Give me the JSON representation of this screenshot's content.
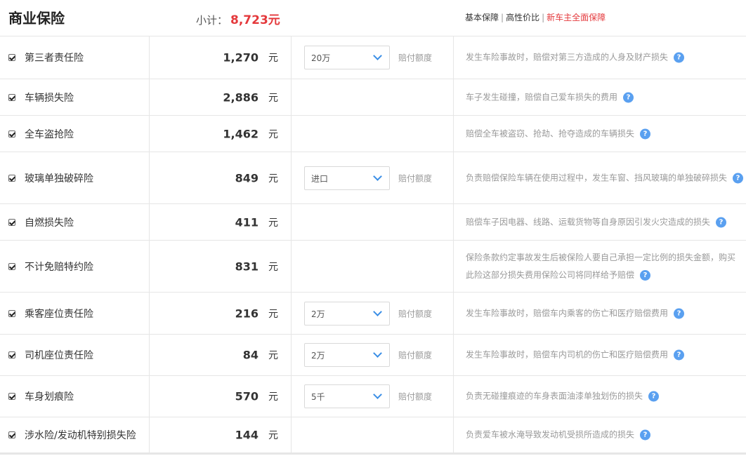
{
  "header": {
    "title": "商业保险",
    "subtotal_label": "小计：",
    "subtotal_amount": "8,723元",
    "toggles": [
      {
        "label": "基本保障"
      },
      {
        "label": "高性价比"
      },
      {
        "label": "新车主全面保障"
      }
    ],
    "active_color": "#e4393c"
  },
  "unit_label": "元",
  "option_label": "赔付额度",
  "rows": [
    {
      "name": "第三者责任险",
      "price": "1,270",
      "option": "20万",
      "desc": "发生车险事故时，赔偿对第三方造成的人身及财产损失",
      "checked": true
    },
    {
      "name": "车辆损失险",
      "price": "2,886",
      "option": null,
      "desc": "车子发生碰撞，赔偿自己爱车损失的费用",
      "checked": true
    },
    {
      "name": "全车盗抢险",
      "price": "1,462",
      "option": null,
      "desc": "赔偿全车被盗窃、抢劫、抢夺造成的车辆损失",
      "checked": true
    },
    {
      "name": "玻璃单独破碎险",
      "price": "849",
      "option": "进口",
      "desc": "负责赔偿保险车辆在使用过程中，发生车窗、挡风玻璃的单独破碎损失",
      "checked": true
    },
    {
      "name": "自燃损失险",
      "price": "411",
      "option": null,
      "desc": "赔偿车子因电器、线路、运载货物等自身原因引发火灾造成的损失",
      "checked": true
    },
    {
      "name": "不计免赔特约险",
      "price": "831",
      "option": null,
      "desc": "保险条款约定事故发生后被保险人要自己承担一定比例的损失金额，购买此险这部分损失费用保险公司将同样给予赔偿",
      "checked": true
    },
    {
      "name": "乘客座位责任险",
      "price": "216",
      "option": "2万",
      "desc": "发生车险事故时，赔偿车内乘客的伤亡和医疗赔偿费用",
      "checked": true
    },
    {
      "name": "司机座位责任险",
      "price": "84",
      "option": "2万",
      "desc": "发生车险事故时，赔偿车内司机的伤亡和医疗赔偿费用",
      "checked": true
    },
    {
      "name": "车身划痕险",
      "price": "570",
      "option": "5千",
      "desc": "负责无碰撞痕迹的车身表面油漆单独划伤的损失",
      "checked": true
    },
    {
      "name": "涉水险/发动机特别损失险",
      "price": "144",
      "option": null,
      "desc": "负责爱车被水淹导致发动机受损所造成的损失",
      "checked": true
    }
  ],
  "icons": {
    "help": "question-circle-icon",
    "checkbox": "checkbox-icon",
    "dropdown": "chevron-down-icon"
  },
  "help_color": "#5aa0f0",
  "help_glyph": "?"
}
